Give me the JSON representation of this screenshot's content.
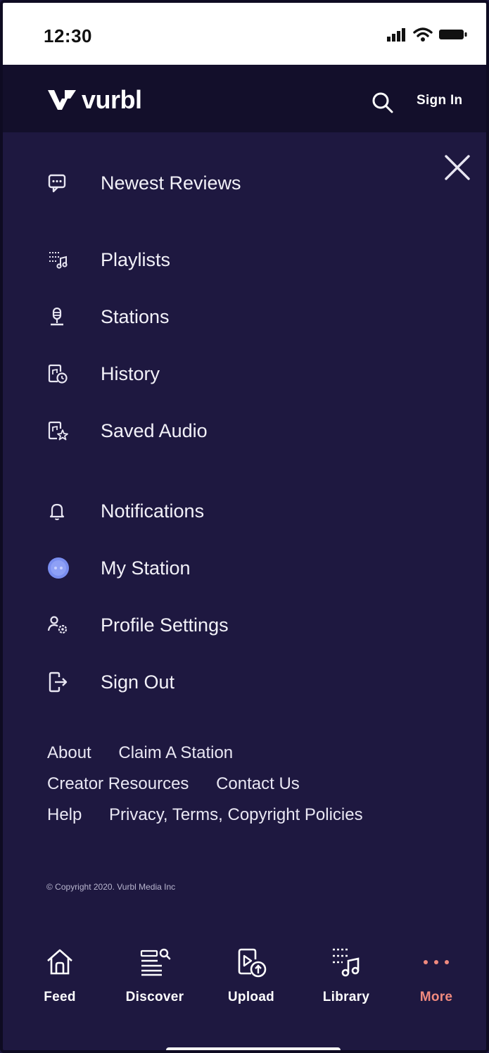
{
  "status_bar": {
    "time": "12:30",
    "icons": [
      "signal-icon",
      "wifi-icon",
      "battery-icon"
    ]
  },
  "header": {
    "logo_text": "vurbl",
    "logo_icon": "vurbl-v-logo-icon",
    "search_icon": "search-icon",
    "sign_in_label": "Sign In"
  },
  "menu": {
    "close_icon": "close-icon",
    "items": [
      {
        "label": "Newest Reviews",
        "icon": "chat-bubble-icon"
      },
      {
        "label": "Playlists",
        "icon": "playlist-music-icon"
      },
      {
        "label": "Stations",
        "icon": "microphone-icon"
      },
      {
        "label": "History",
        "icon": "history-clock-icon"
      },
      {
        "label": "Saved Audio",
        "icon": "saved-star-icon"
      },
      {
        "label": "Notifications",
        "icon": "bell-icon"
      },
      {
        "label": "My Station",
        "icon": "station-avatar-icon"
      },
      {
        "label": "Profile Settings",
        "icon": "profile-settings-icon"
      },
      {
        "label": "Sign Out",
        "icon": "sign-out-icon"
      }
    ]
  },
  "footer_links": {
    "about": "About",
    "claim_station": "Claim A Station",
    "creator_resources": "Creator Resources",
    "contact_us": "Contact Us",
    "help": "Help",
    "policies": "Privacy, Terms, Copyright Policies"
  },
  "copyright": "© Copyright 2020. Vurbl Media Inc",
  "tabbar": {
    "active": "More",
    "tabs": [
      {
        "label": "Feed",
        "icon": "home-icon"
      },
      {
        "label": "Discover",
        "icon": "discover-search-list-icon"
      },
      {
        "label": "Upload",
        "icon": "upload-icon"
      },
      {
        "label": "Library",
        "icon": "library-music-icon"
      },
      {
        "label": "More",
        "icon": "more-dots-icon"
      }
    ]
  },
  "colors": {
    "background": "#1e1840",
    "header": "#130f2b",
    "active_tab": "#f08a7e",
    "station_avatar": "#7a8ef0"
  }
}
